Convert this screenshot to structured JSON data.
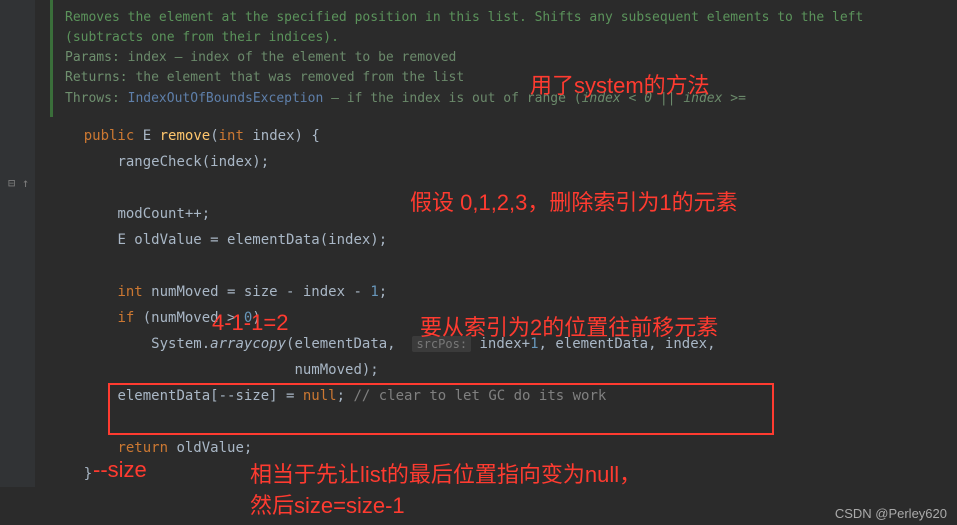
{
  "javadoc": {
    "summary": "Removes the element at the specified position in this list. Shifts any subsequent elements to the left (subtracts one from their indices).",
    "params_label": "Params:",
    "params_text": "index – index of the element to be removed",
    "returns_label": "Returns:",
    "returns_text": "the element that was removed from the list",
    "throws_label": "Throws:",
    "throws_link": "IndexOutOfBoundsException",
    "throws_text": " – if the index is out of range (",
    "throws_code": "index < 0 || index >="
  },
  "code": {
    "kw_public": "public",
    "type_E": "E",
    "method_remove": "remove",
    "kw_int": "int",
    "param_index": "index",
    "rangeCheck": "rangeCheck(index);",
    "modCount": "modCount++;",
    "oldValue_decl": "E oldValue = elementData(index);",
    "numMoved_decl_left": "int",
    "numMoved_decl_right": " numMoved = size - index - ",
    "one": "1",
    "semicolon": ";",
    "if_head": "if",
    "if_cond": " (numMoved > ",
    "zero": "0",
    "paren_close": ")",
    "system_arraycopy_a": "System.",
    "system_arraycopy_b": "arraycopy",
    "system_arraycopy_c": "(elementData,  ",
    "srcpos_hint": "srcPos:",
    "system_arraycopy_d": " index+",
    "system_arraycopy_e": ", elementData, index,",
    "system_arraycopy_f": "numMoved);",
    "ed_nullsize": "elementData[--size] = ",
    "kw_null": "null",
    "ed_comment": "// clear to let GC do its work",
    "kw_return": "return",
    "return_val": " oldValue;",
    "brace_open": " {",
    "brace_close": "}"
  },
  "annotations": {
    "a1": "用了system的方法",
    "a2": "假设 0,1,2,3，删除索引为1的元素",
    "a3": "4-1-1=2",
    "a4": "要从索引为2的位置往前移元素",
    "a5": "--size",
    "a6a": "相当于先让list的最后位置指向变为null，",
    "a6b": "然后size=size-1"
  },
  "watermark": "CSDN @Perley620"
}
